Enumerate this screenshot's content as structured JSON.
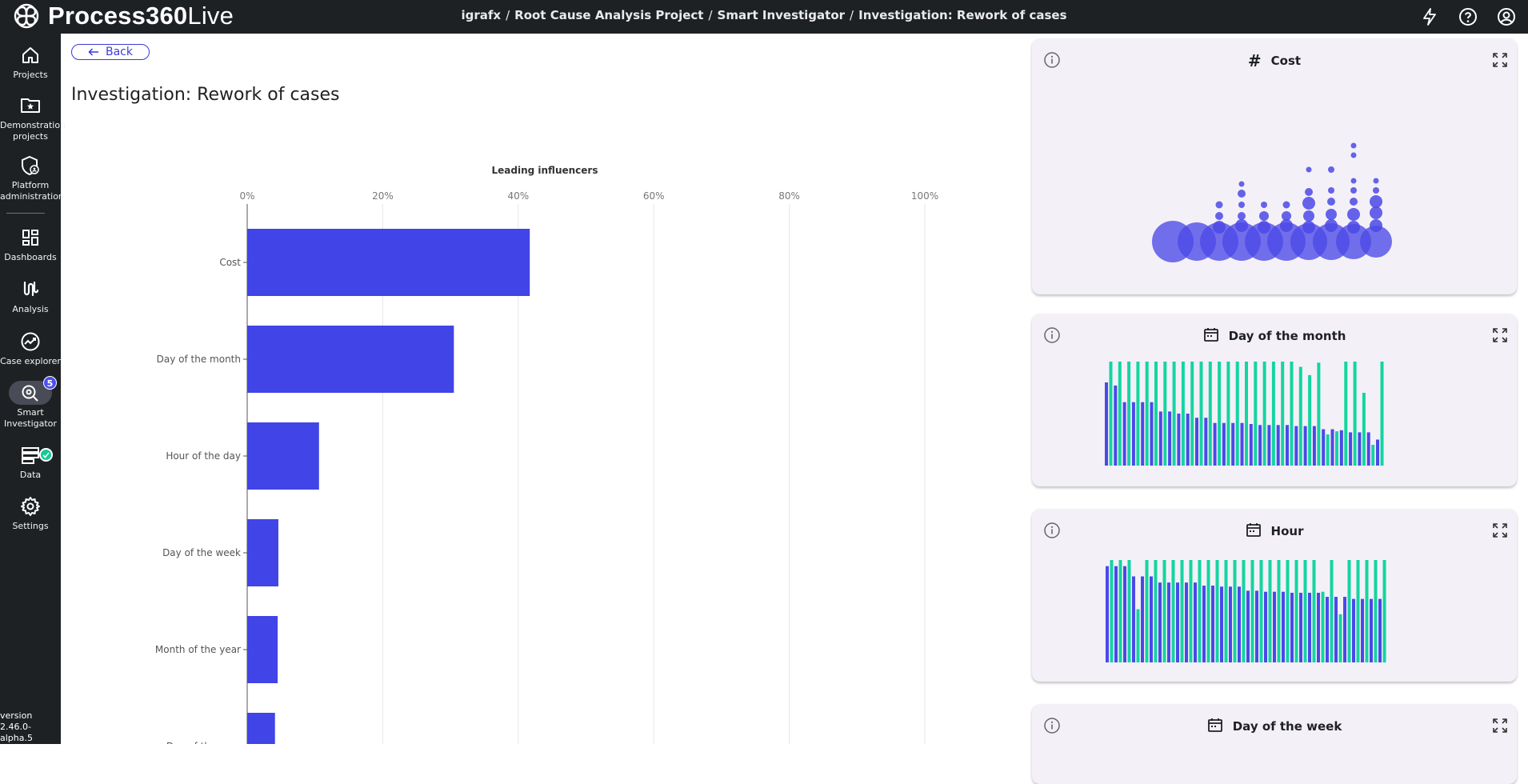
{
  "app": {
    "logo_main": "Process360",
    "logo_suffix": "Live"
  },
  "breadcrumb": [
    "igrafx",
    "Root Cause Analysis Project",
    "Smart Investigator",
    "Investigation: Rework of cases"
  ],
  "top_icons": [
    "bolt-icon",
    "help-icon",
    "user-icon"
  ],
  "sidebar": {
    "items": [
      {
        "label": "Projects",
        "icon": "home-icon"
      },
      {
        "label": "Demonstration projects",
        "icon": "star-folder-icon"
      },
      {
        "label": "Platform administration",
        "icon": "shield-icon"
      },
      {
        "label": "Dashboards",
        "icon": "dashboard-icon"
      },
      {
        "label": "Analysis",
        "icon": "analysis-icon"
      },
      {
        "label": "Case explorer",
        "icon": "trend-icon"
      },
      {
        "label": "Smart Investigator",
        "icon": "investigate-icon",
        "badge": "5"
      },
      {
        "label": "Data",
        "icon": "data-icon"
      },
      {
        "label": "Settings",
        "icon": "gear-icon"
      }
    ],
    "version": "version 2.46.0-alpha.5"
  },
  "main": {
    "back_label": "Back",
    "title": "Investigation: Rework of cases"
  },
  "chart_data": {
    "type": "bar",
    "orientation": "horizontal",
    "title": "Leading influencers",
    "categories": [
      "Cost",
      "Day of the month",
      "Hour of the day",
      "Day of the week",
      "Month of the year",
      "Day of the year"
    ],
    "values": [
      41.7,
      30.5,
      10.6,
      4.6,
      4.5,
      4.1
    ],
    "xlim": [
      0,
      100
    ],
    "xticks": [
      "0%",
      "20%",
      "40%",
      "60%",
      "80%",
      "100%"
    ],
    "grid": true,
    "color": "#4144e6"
  },
  "cards": [
    {
      "title": "Cost",
      "icon": "hash-icon",
      "kind": "bubbles"
    },
    {
      "title": "Day of the month",
      "icon": "calendar-icon",
      "kind": "bars",
      "series": {
        "blue": [
          0.8,
          0.77,
          0.61,
          0.61,
          0.61,
          0.61,
          0.52,
          0.52,
          0.5,
          0.5,
          0.46,
          0.46,
          0.41,
          0.41,
          0.41,
          0.41,
          0.4,
          0.39,
          0.39,
          0.39,
          0.39,
          0.38,
          0.38,
          0.38,
          0.35,
          0.35,
          0.34,
          0.32,
          0.32,
          0.32,
          0.25
        ],
        "green": [
          1,
          1,
          1,
          1,
          1,
          1,
          1,
          1,
          1,
          1,
          1,
          1,
          1,
          1,
          1,
          1,
          1,
          1,
          1,
          1,
          1,
          0.95,
          0.87,
          0.99,
          0.3,
          0.33,
          1,
          1,
          0.7,
          0.2,
          1
        ]
      },
      "colors": {
        "blue": "#4b49e8",
        "green": "#13d5a1"
      }
    },
    {
      "title": "Hour",
      "icon": "calendar-icon",
      "kind": "bars",
      "series": {
        "blue": [
          0.94,
          0.94,
          0.94,
          0.84,
          0.84,
          0.84,
          0.78,
          0.78,
          0.78,
          0.78,
          0.78,
          0.75,
          0.75,
          0.74,
          0.74,
          0.74,
          0.7,
          0.7,
          0.69,
          0.69,
          0.69,
          0.68,
          0.68,
          0.68,
          0.68,
          0.64,
          0.64,
          0.64,
          0.62,
          0.62,
          0.62,
          0.62
        ],
        "green": [
          1,
          1,
          1,
          0.52,
          1,
          1,
          1,
          1,
          1,
          1,
          1,
          1,
          1,
          1,
          1,
          1,
          1,
          1,
          1,
          1,
          1,
          1,
          1,
          1,
          0.69,
          1,
          0.47,
          1,
          1,
          1,
          1,
          1
        ]
      },
      "colors": {
        "blue": "#4b49e8",
        "green": "#13d5a1"
      }
    },
    {
      "title": "Day of the week",
      "icon": "calendar-icon",
      "kind": "bars"
    }
  ]
}
